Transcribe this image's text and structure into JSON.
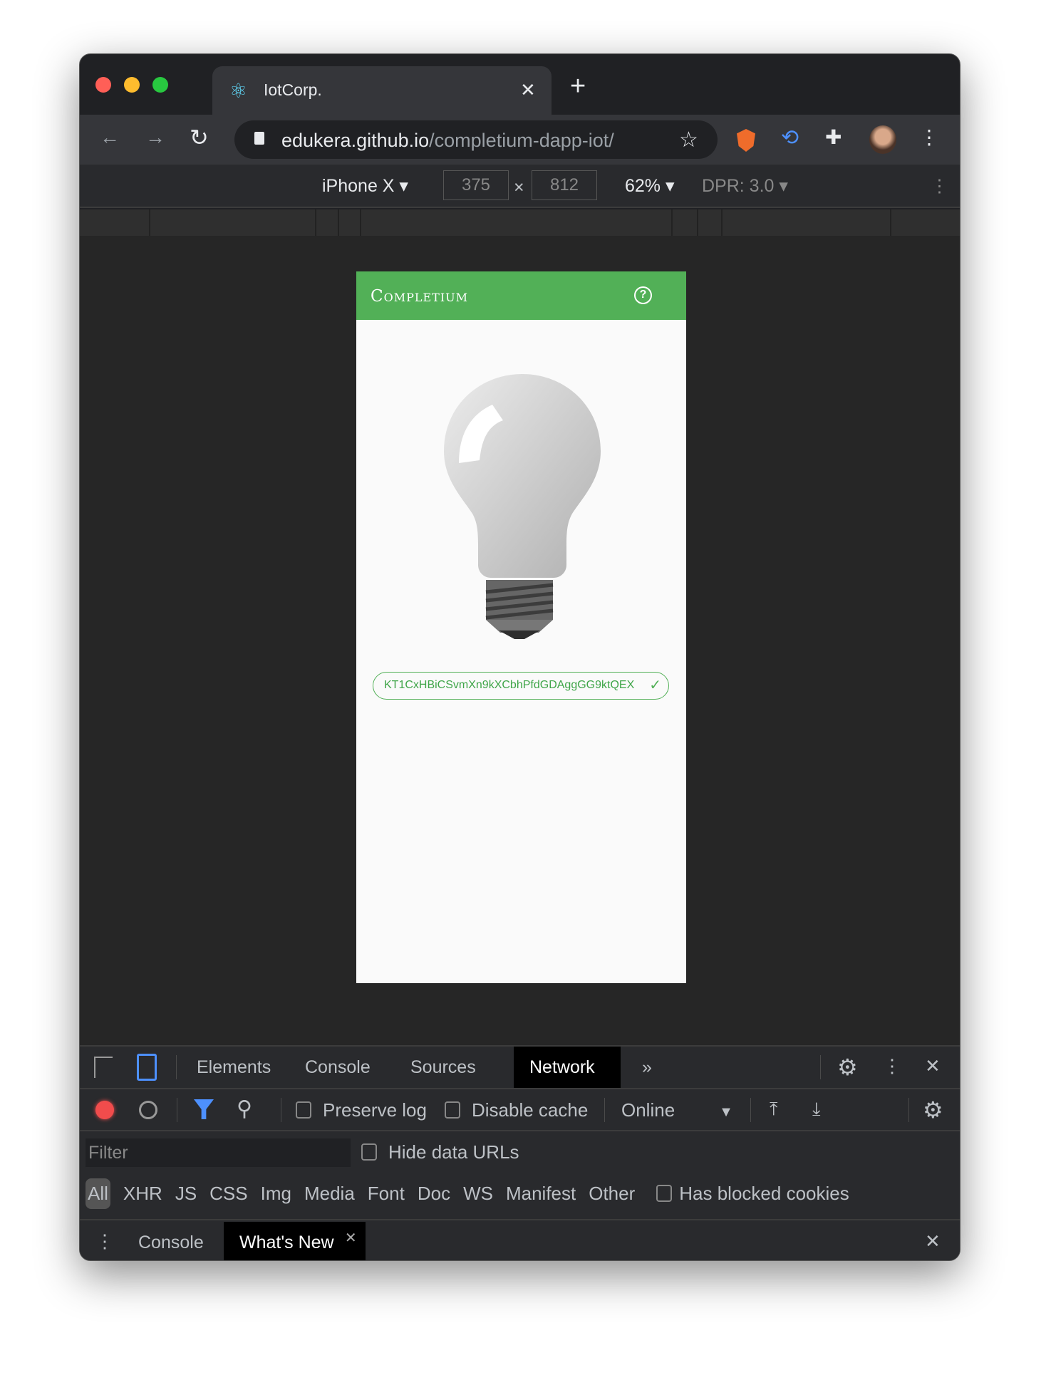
{
  "browser": {
    "tab_title": "IotCorp.",
    "url_host": "edukera.github.io",
    "url_path": "/completium-dapp-iot/"
  },
  "device_toolbar": {
    "device": "iPhone X",
    "width": "375",
    "height": "812",
    "times": "×",
    "zoom": "62%",
    "dpr": "DPR: 3.0"
  },
  "app": {
    "brand": "Completium",
    "help_icon": "?",
    "contract_address": "KT1CxHBiCSvmXn9kXCbhPfdGDAggGG9ktQEX",
    "bulb_state": "off"
  },
  "devtools": {
    "tabs": [
      "Elements",
      "Console",
      "Sources",
      "Network"
    ],
    "active_tab": "Network",
    "more": "»",
    "network": {
      "preserve_log": "Preserve log",
      "disable_cache": "Disable cache",
      "throttling": "Online",
      "filter_placeholder": "Filter",
      "hide_data_urls": "Hide data URLs",
      "types": [
        "All",
        "XHR",
        "JS",
        "CSS",
        "Img",
        "Media",
        "Font",
        "Doc",
        "WS",
        "Manifest",
        "Other"
      ],
      "has_blocked_cookies": "Has blocked cookies"
    },
    "drawer": {
      "tabs": [
        "Console",
        "What's New"
      ],
      "active": "What's New"
    }
  },
  "colors": {
    "accent_green": "#52b057",
    "record_red": "#f14c4c",
    "devtools_blue": "#4d90fe"
  }
}
